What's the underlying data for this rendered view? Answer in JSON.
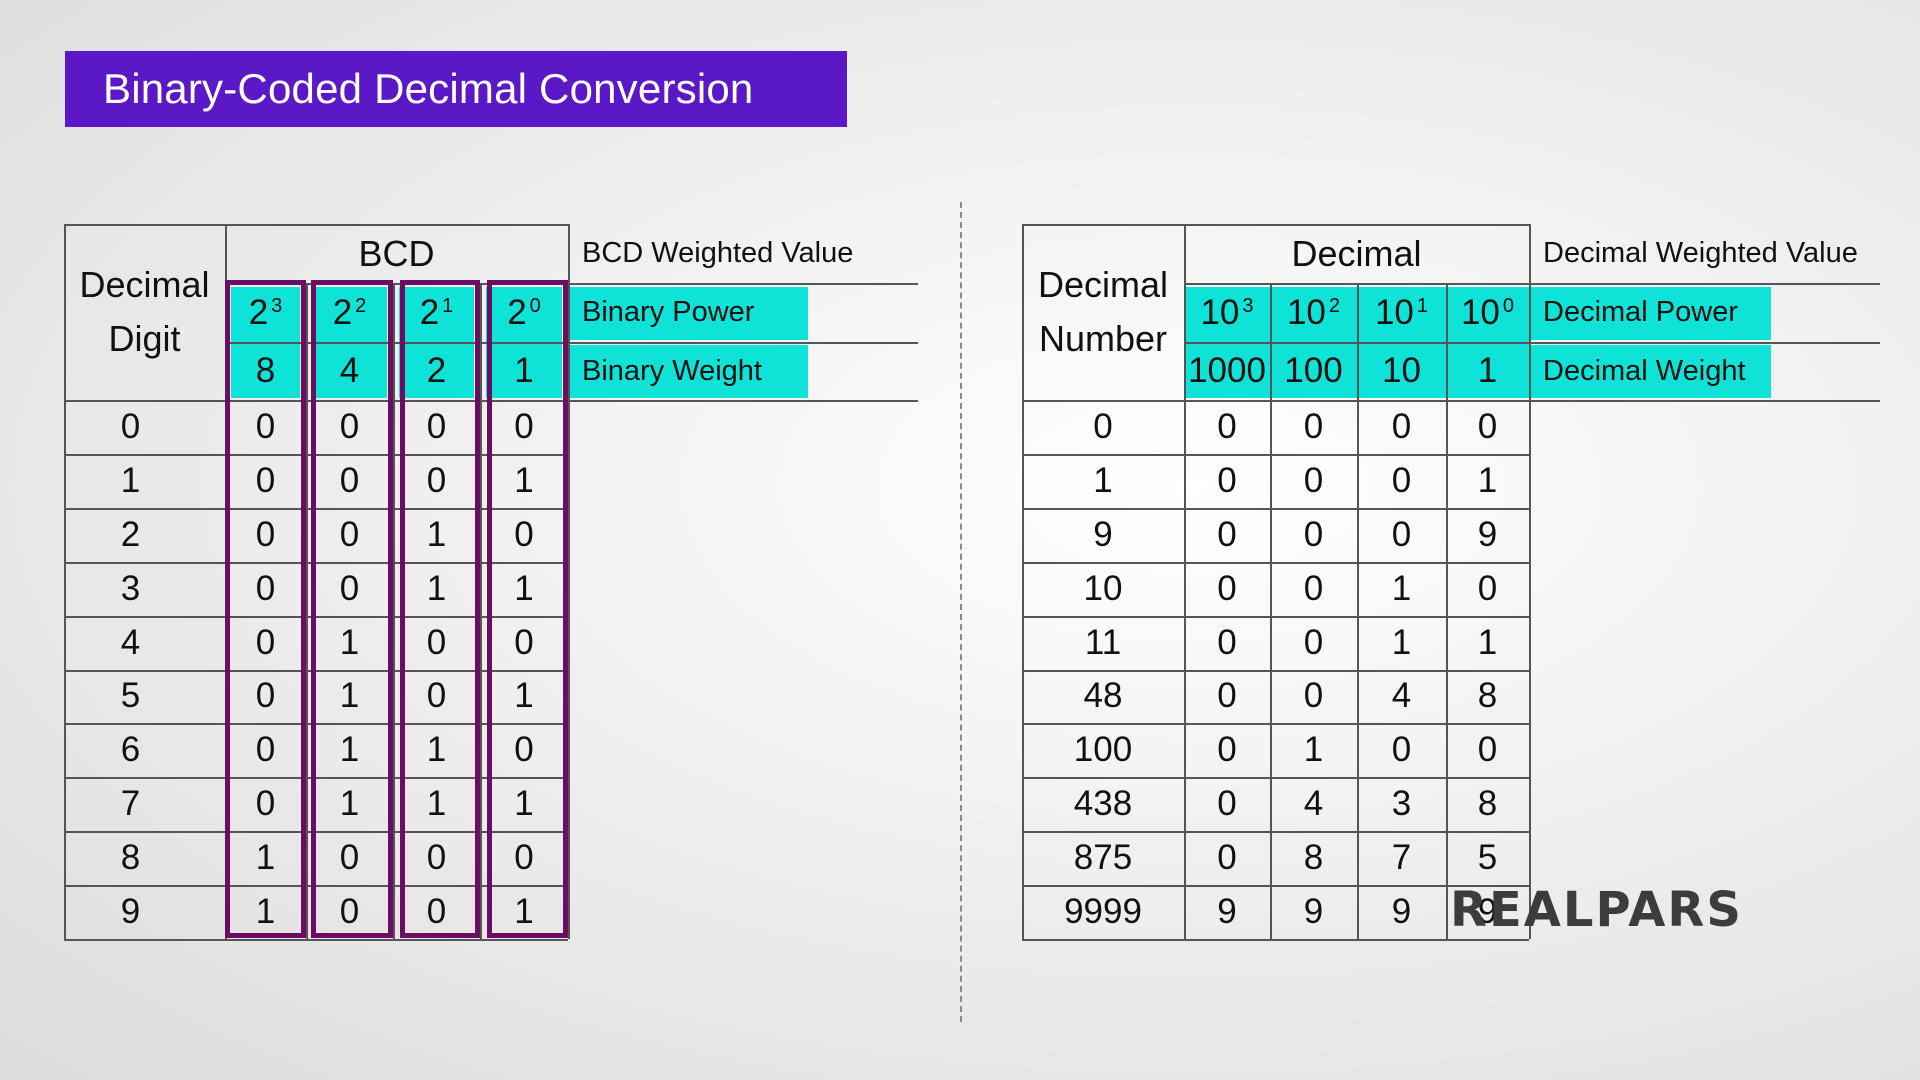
{
  "title": "Binary-Coded Decimal  Conversion",
  "bcd_table": {
    "row_header": [
      "Decimal",
      "Digit"
    ],
    "group_header": "BCD",
    "weighted_value_label": "BCD Weighted Value",
    "power_label": "Binary Power",
    "weight_label": "Binary Weight",
    "powers": [
      {
        "base": "2",
        "exp": "3"
      },
      {
        "base": "2",
        "exp": "2"
      },
      {
        "base": "2",
        "exp": "1"
      },
      {
        "base": "2",
        "exp": "0"
      }
    ],
    "weights": [
      "8",
      "4",
      "2",
      "1"
    ],
    "rows": [
      {
        "digit": "0",
        "bits": [
          "0",
          "0",
          "0",
          "0"
        ]
      },
      {
        "digit": "1",
        "bits": [
          "0",
          "0",
          "0",
          "1"
        ]
      },
      {
        "digit": "2",
        "bits": [
          "0",
          "0",
          "1",
          "0"
        ]
      },
      {
        "digit": "3",
        "bits": [
          "0",
          "0",
          "1",
          "1"
        ]
      },
      {
        "digit": "4",
        "bits": [
          "0",
          "1",
          "0",
          "0"
        ]
      },
      {
        "digit": "5",
        "bits": [
          "0",
          "1",
          "0",
          "1"
        ]
      },
      {
        "digit": "6",
        "bits": [
          "0",
          "1",
          "1",
          "0"
        ]
      },
      {
        "digit": "7",
        "bits": [
          "0",
          "1",
          "1",
          "1"
        ]
      },
      {
        "digit": "8",
        "bits": [
          "1",
          "0",
          "0",
          "0"
        ]
      },
      {
        "digit": "9",
        "bits": [
          "1",
          "0",
          "0",
          "1"
        ]
      }
    ]
  },
  "decimal_table": {
    "row_header": [
      "Decimal",
      "Number"
    ],
    "group_header": "Decimal",
    "weighted_value_label": "Decimal Weighted Value",
    "power_label": "Decimal Power",
    "weight_label": "Decimal Weight",
    "powers": [
      {
        "base": "10",
        "exp": "3"
      },
      {
        "base": "10",
        "exp": "2"
      },
      {
        "base": "10",
        "exp": "1"
      },
      {
        "base": "10",
        "exp": "0"
      }
    ],
    "weights": [
      "1000",
      "100",
      "10",
      "1"
    ],
    "rows": [
      {
        "number": "0",
        "digits": [
          "0",
          "0",
          "0",
          "0"
        ]
      },
      {
        "number": "1",
        "digits": [
          "0",
          "0",
          "0",
          "1"
        ]
      },
      {
        "number": "9",
        "digits": [
          "0",
          "0",
          "0",
          "9"
        ]
      },
      {
        "number": "10",
        "digits": [
          "0",
          "0",
          "1",
          "0"
        ]
      },
      {
        "number": "11",
        "digits": [
          "0",
          "0",
          "1",
          "1"
        ]
      },
      {
        "number": "48",
        "digits": [
          "0",
          "0",
          "4",
          "8"
        ]
      },
      {
        "number": "100",
        "digits": [
          "0",
          "1",
          "0",
          "0"
        ]
      },
      {
        "number": "438",
        "digits": [
          "0",
          "4",
          "3",
          "8"
        ]
      },
      {
        "number": "875",
        "digits": [
          "0",
          "8",
          "7",
          "5"
        ]
      },
      {
        "number": "9999",
        "digits": [
          "9",
          "9",
          "9",
          "9"
        ]
      }
    ]
  },
  "logo": "REALPARS",
  "colors": {
    "title_bg": "#5a18c6",
    "highlight": "#0fe3d8",
    "column_box": "#6a0d63"
  }
}
